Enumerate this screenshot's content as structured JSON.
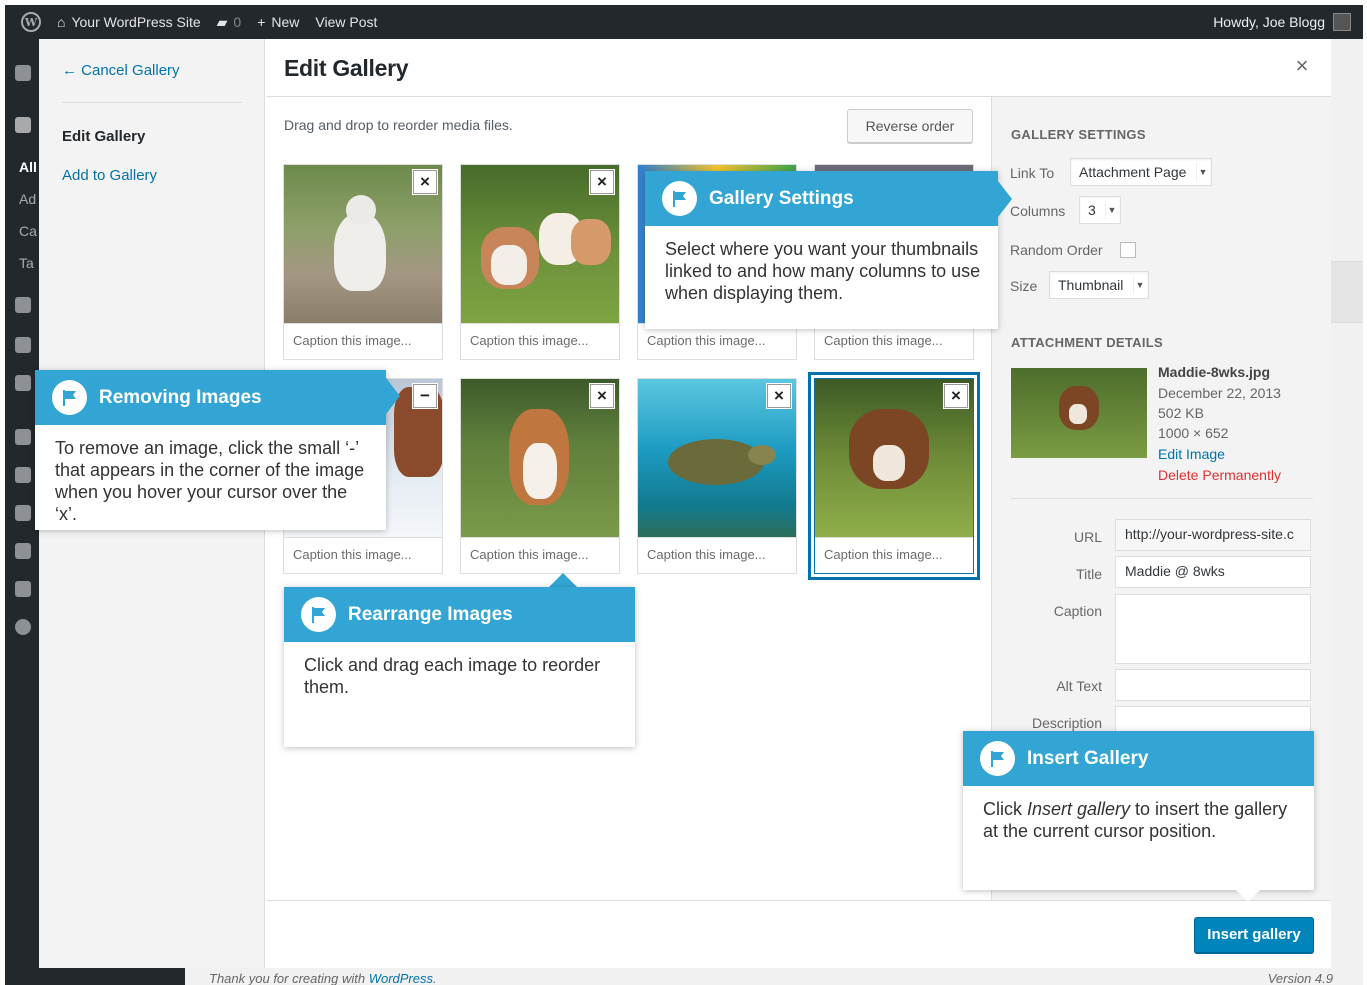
{
  "adminbar": {
    "site_name": "Your WordPress Site",
    "comments_count": "0",
    "new_label": "New",
    "view_post": "View Post",
    "howdy": "Howdy, Joe Blogg"
  },
  "adminmenu_partial": [
    "All",
    "Ad",
    "Ca",
    "Ta"
  ],
  "footer": {
    "thanks_prefix": "Thank you for creating with ",
    "thanks_link": "WordPress",
    "thanks_suffix": ".",
    "version": "Version 4.9"
  },
  "modal": {
    "cancel_gallery": "← Cancel Gallery",
    "menu_current": "Edit Gallery",
    "add_to_gallery": "Add to Gallery",
    "title": "Edit Gallery",
    "close": "×",
    "hint": "Drag and drop to reorder media files.",
    "reverse_order": "Reverse order",
    "insert_gallery": "Insert gallery"
  },
  "gallery": {
    "caption_placeholder": "Caption this image...",
    "items": [
      {
        "subject": "kitten",
        "remove": "×"
      },
      {
        "subject": "bulldog-puppies",
        "remove": "×"
      },
      {
        "subject": "colorful-blocks",
        "remove": "×"
      },
      {
        "subject": "gray-animal",
        "remove": "×"
      },
      {
        "subject": "horse-in-snow",
        "remove": "−"
      },
      {
        "subject": "beagle-puppy",
        "remove": "×"
      },
      {
        "subject": "sea-turtle",
        "remove": "×"
      },
      {
        "subject": "boxer-puppy",
        "remove": "×"
      }
    ]
  },
  "settings": {
    "heading": "GALLERY SETTINGS",
    "link_to_label": "Link To",
    "link_to_value": "Attachment Page",
    "columns_label": "Columns",
    "columns_value": "3",
    "random_order_label": "Random Order",
    "random_order_checked": false,
    "size_label": "Size",
    "size_value": "Thumbnail"
  },
  "attachment": {
    "heading": "ATTACHMENT DETAILS",
    "filename": "Maddie-8wks.jpg",
    "date": "December 22, 2013",
    "filesize": "502 KB",
    "dimensions": "1000 × 652",
    "edit_image": "Edit Image",
    "delete": "Delete Permanently",
    "url_label": "URL",
    "url_value": "http://your-wordpress-site.c",
    "title_label": "Title",
    "title_value": "Maddie @ 8wks",
    "caption_label": "Caption",
    "caption_value": "",
    "alt_label": "Alt Text",
    "alt_value": "",
    "description_label": "Description",
    "description_value": ""
  },
  "callouts": {
    "gallery_settings": {
      "title": "Gallery Settings",
      "body": "Select where you want  your thumbnails linked to and how many columns to use when displaying them."
    },
    "removing_images": {
      "title": "Removing Images",
      "body": "To remove an image, click the small ‘-’ that appears in the corner of the image when you hover your cursor over the ‘x’."
    },
    "rearrange_images": {
      "title": "Rearrange Images",
      "body": "Click and drag each image to reorder them."
    },
    "insert_gallery": {
      "title": "Insert Gallery",
      "body_prefix": "Click ",
      "body_em": "Insert gallery",
      "body_suffix": " to insert the gallery at the current cursor position."
    }
  },
  "colors": {
    "admin_dark": "#23282d",
    "link": "#0073aa",
    "callout_header": "#33a5d4",
    "primary_button": "#0085ba",
    "delete": "#dc3232"
  }
}
